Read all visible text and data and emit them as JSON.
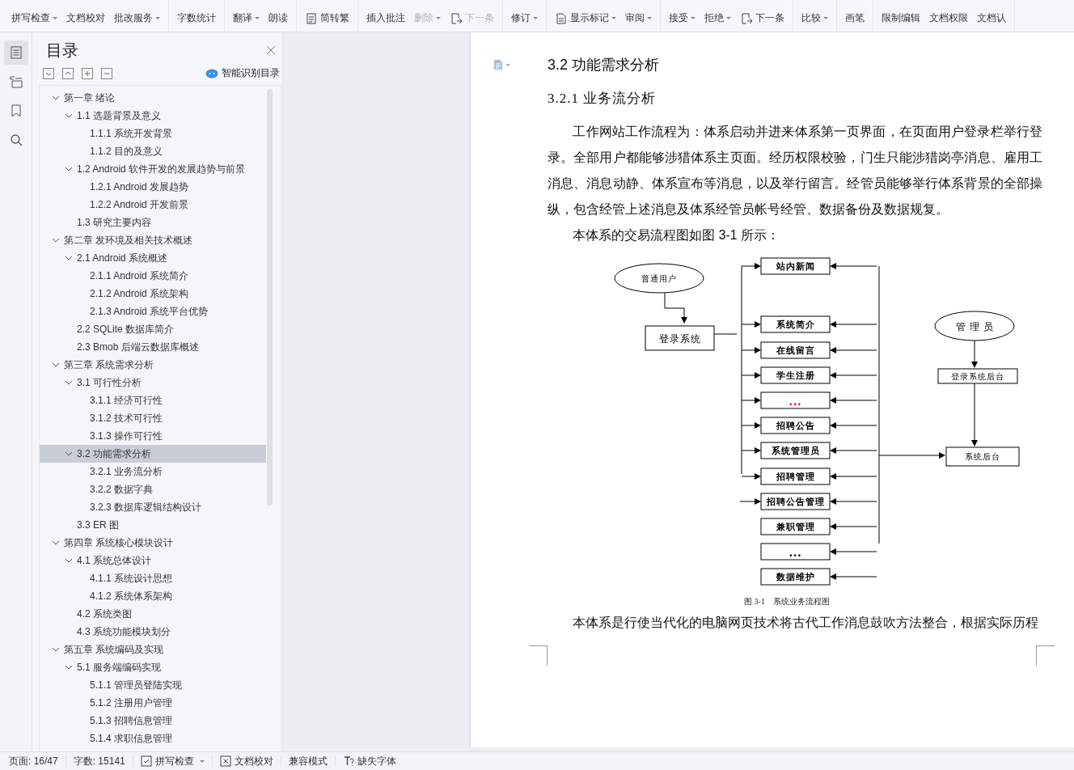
{
  "ribbon": {
    "groups": [
      [
        {
          "label": "拼写检查",
          "dropdown": true,
          "disabled": false
        },
        {
          "label": "文档校对",
          "dropdown": false,
          "disabled": false
        },
        {
          "label": "批改服务",
          "dropdown": true,
          "disabled": false
        }
      ],
      [
        {
          "label": "字数统计",
          "dropdown": false,
          "disabled": false
        }
      ],
      [
        {
          "label": "翻译",
          "dropdown": true,
          "disabled": false
        },
        {
          "label": "朗读",
          "dropdown": false,
          "disabled": false
        }
      ],
      [
        {
          "label": "简转繁",
          "dropdown": false,
          "disabled": false,
          "kind": "convert"
        }
      ],
      [
        {
          "label": "插入批注",
          "dropdown": false,
          "disabled": false
        },
        {
          "label": "删除",
          "dropdown": true,
          "disabled": true
        },
        {
          "label": "下一条",
          "dropdown": false,
          "disabled": true,
          "kind": "next"
        }
      ],
      [
        {
          "label": "修订",
          "dropdown": true,
          "disabled": false
        }
      ],
      [
        {
          "label": "显示标记",
          "dropdown": true,
          "disabled": false,
          "kind": "markup"
        },
        {
          "label": "审阅",
          "dropdown": true,
          "disabled": false
        }
      ],
      [
        {
          "label": "接受",
          "dropdown": true,
          "disabled": false
        },
        {
          "label": "拒绝",
          "dropdown": true,
          "disabled": false
        },
        {
          "label": "下一条",
          "dropdown": false,
          "disabled": false,
          "kind": "next"
        }
      ],
      [
        {
          "label": "比较",
          "dropdown": true,
          "disabled": false
        }
      ],
      [
        {
          "label": "画笔",
          "dropdown": false,
          "disabled": false
        }
      ],
      [
        {
          "label": "限制编辑",
          "dropdown": false,
          "disabled": false
        },
        {
          "label": "文档权限",
          "dropdown": false,
          "disabled": false
        },
        {
          "label": "文档认",
          "dropdown": false,
          "disabled": false
        }
      ]
    ]
  },
  "nav_rail": {
    "tabs": [
      {
        "kind": "contents",
        "selected": true
      },
      {
        "kind": "outline",
        "selected": false
      },
      {
        "kind": "bookmarks",
        "selected": false
      },
      {
        "kind": "search",
        "selected": false
      }
    ]
  },
  "toc": {
    "title": "目录",
    "smart_button": "智能识别目录",
    "items": [
      {
        "label": "第一章  绪论",
        "selected": false,
        "expanded": true,
        "children": [
          {
            "label": "1.1 选题背景及意义",
            "selected": false,
            "expanded": true,
            "children": [
              {
                "label": "1.1.1 系统开发背景",
                "selected": false
              },
              {
                "label": "1.1.2 目的及意义",
                "selected": false
              }
            ]
          },
          {
            "label": "1.2 Android 软件开发的发展趋势与前景",
            "selected": false,
            "expanded": true,
            "children": [
              {
                "label": "1.2.1 Android 发展趋势",
                "selected": false
              },
              {
                "label": "1.2.2 Android 开发前景",
                "selected": false
              }
            ]
          },
          {
            "label": "1.3 研究主要内容",
            "selected": false
          }
        ]
      },
      {
        "label": "第二章  发环境及相关技术概述",
        "selected": false,
        "expanded": true,
        "children": [
          {
            "label": "2.1 Android 系统概述",
            "selected": false,
            "expanded": true,
            "children": [
              {
                "label": "2.1.1 Android 系统简介",
                "selected": false
              },
              {
                "label": "2.1.2 Android 系统架构",
                "selected": false
              },
              {
                "label": "2.1.3 Android 系统平台优势",
                "selected": false
              }
            ]
          },
          {
            "label": "2.2 SQLite 数据库简介",
            "selected": false
          },
          {
            "label": "2.3 Bmob 后端云数据库概述",
            "selected": false
          }
        ]
      },
      {
        "label": "第三章  系统需求分析",
        "selected": false,
        "expanded": true,
        "children": [
          {
            "label": "3.1 可行性分析",
            "selected": false,
            "expanded": true,
            "children": [
              {
                "label": "3.1.1 经济可行性",
                "selected": false
              },
              {
                "label": "3.1.2 技术可行性",
                "selected": false
              },
              {
                "label": "3.1.3 操作可行性",
                "selected": false
              }
            ]
          },
          {
            "label": "3.2 功能需求分析",
            "selected": true,
            "expanded": true,
            "children": [
              {
                "label": "3.2.1 业务流分析",
                "selected": false
              },
              {
                "label": "3.2.2 数据字典",
                "selected": false
              },
              {
                "label": "3.2.3 数据库逻辑结构设计",
                "selected": false
              }
            ]
          },
          {
            "label": "3.3 ER 图",
            "selected": false
          }
        ]
      },
      {
        "label": "第四章  系统核心模块设计",
        "selected": false,
        "expanded": true,
        "children": [
          {
            "label": "4.1 系统总体设计",
            "selected": false,
            "expanded": true,
            "children": [
              {
                "label": "4.1.1  系统设计思想",
                "selected": false
              },
              {
                "label": "4.1.2  系统体系架构",
                "selected": false
              }
            ]
          },
          {
            "label": "4.2 系统类图",
            "selected": false
          },
          {
            "label": "4.3 系统功能模块划分",
            "selected": false
          }
        ]
      },
      {
        "label": "第五章  系统编码及实现",
        "selected": false,
        "expanded": true,
        "children": [
          {
            "label": "5.1  服务端编码实现",
            "selected": false,
            "expanded": true,
            "children": [
              {
                "label": "5.1.1 管理员登陆实现",
                "selected": false
              },
              {
                "label": "5.1.2  注册用户管理",
                "selected": false
              },
              {
                "label": "5.1.3  招聘信息管理",
                "selected": false
              },
              {
                "label": "5.1.4  求职信息管理",
                "selected": false
              }
            ]
          }
        ]
      }
    ]
  },
  "document": {
    "heading": "3.2 功能需求分析",
    "subheading": "3.2.1 业务流分析",
    "paragraphs": [
      "工作网站工作流程为：体系启动并进来体系第一页界面，在页面用户登录栏举行登录。全部用户都能够涉猎体系主页面。经历权限校验，门生只能涉猎岗亭消息、雇用工消息、消息动静、体系宣布等消息，以及举行留言。经管员能够举行体系背景的全部操纵，包含经管上述消息及体系经管员帐号经管、数据备份及数据规复。",
      "本体系的交易流程图如图 3-1 所示："
    ],
    "flowchart": {
      "user": "普通用户",
      "login": "登录系统",
      "admin": "管 理 员",
      "admin_login": "登录系统后台",
      "backend": "系统后台",
      "modules": [
        {
          "label": "站内新闻",
          "color": "#000000",
          "user_link": true
        },
        {
          "label": "系统简介",
          "color": "#000000",
          "user_link": true
        },
        {
          "label": "在线留言",
          "color": "#000000",
          "user_link": true
        },
        {
          "label": "学生注册",
          "color": "#000000",
          "user_link": true
        },
        {
          "label": "...",
          "color": "#ff0000",
          "user_link": true
        },
        {
          "label": "招聘公告",
          "color": "#000000",
          "user_link": true
        },
        {
          "label": "系统管理员",
          "color": "#000000",
          "user_link": true
        },
        {
          "label": "招聘管理",
          "color": "#000000",
          "user_link": true
        },
        {
          "label": "招聘公告管理",
          "color": "#000000",
          "user_link": true
        },
        {
          "label": "兼职管理",
          "color": "#000000",
          "user_link": false
        },
        {
          "label": "...",
          "color": "#000000",
          "user_link": false
        },
        {
          "label": "数据维护",
          "color": "#000000",
          "user_link": false
        }
      ],
      "caption": "图 3-1　系统业务流程图"
    },
    "closing_paragraph": "本体系是行使当代化的电脑网页技术将古代工作消息鼓吹方法整合，根据实际历程"
  },
  "status_bar": {
    "items": [
      {
        "label": "页面: 16/47",
        "dropdown": false
      },
      {
        "label": "字数: 15141",
        "dropdown": false
      },
      {
        "label": "拼写检查",
        "dropdown": true,
        "kind": "check"
      },
      {
        "label": "文档校对",
        "dropdown": false,
        "kind": "cross"
      },
      {
        "label": "兼容模式",
        "dropdown": false
      },
      {
        "label": "缺失字体",
        "dropdown": false,
        "kind": "font"
      }
    ]
  }
}
